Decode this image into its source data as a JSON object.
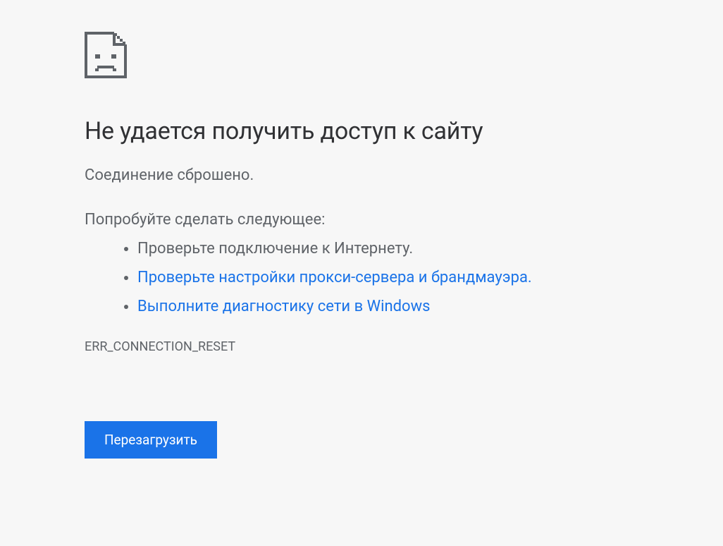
{
  "error": {
    "heading": "Не удается получить доступ к сайту",
    "subtitle": "Соединение сброшено.",
    "suggestions_intro": "Попробуйте сделать следующее:",
    "suggestions": [
      {
        "text": "Проверьте подключение к Интернету.",
        "is_link": false
      },
      {
        "text": "Проверьте настройки прокси-сервера и брандмауэра.",
        "is_link": true
      },
      {
        "text": "Выполните диагностику сети в Windows",
        "is_link": true
      }
    ],
    "error_code": "ERR_CONNECTION_RESET",
    "reload_button": "Перезагрузить"
  }
}
